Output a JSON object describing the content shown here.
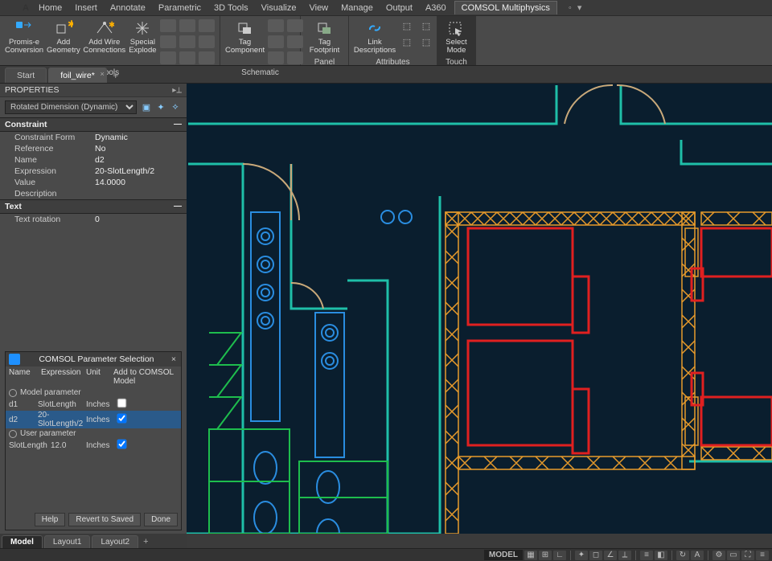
{
  "menu": {
    "items": [
      "Home",
      "Insert",
      "Annotate",
      "Parametric",
      "3D Tools",
      "Visualize",
      "View",
      "Manage",
      "Output",
      "A360"
    ],
    "comsol_tab": "COMSOL Multiphysics",
    "help_glyph": "◦ ▾"
  },
  "ribbon": {
    "groups": {
      "tools": {
        "title": "Tools",
        "buttons": {
          "promise": "Promis-e Conversion",
          "addgeom": "Add Geometry",
          "addwire": "Add Wire Connections",
          "explode": "Special Explode"
        }
      },
      "schematic": {
        "title": "Schematic",
        "buttons": {
          "tagcomp": "Tag Component"
        }
      },
      "panel": {
        "title": "Panel",
        "buttons": {
          "tagfp": "Tag Footprint"
        }
      },
      "attributes": {
        "title": "Attributes",
        "buttons": {
          "linkdesc": "Link Descriptions"
        }
      },
      "touch": {
        "title": "Touch",
        "buttons": {
          "selmode": "Select Mode"
        }
      }
    }
  },
  "file_tabs": {
    "start": "Start",
    "foil": "foil_wire*",
    "add": "+"
  },
  "properties": {
    "title": "PROPERTIES",
    "selection": "Rotated Dimension (Dynamic)",
    "constraint": {
      "header": "Constraint",
      "rows": {
        "form_l": "Constraint Form",
        "form_v": "Dynamic",
        "ref_l": "Reference",
        "ref_v": "No",
        "name_l": "Name",
        "name_v": "d2",
        "expr_l": "Expression",
        "expr_v": "20-SlotLength/2",
        "val_l": "Value",
        "val_v": "14.0000",
        "desc_l": "Description",
        "desc_v": ""
      }
    },
    "text": {
      "header": "Text",
      "rows": {
        "rot_l": "Text rotation",
        "rot_v": "0"
      }
    }
  },
  "comsol_dialog": {
    "title": "COMSOL Parameter Selection",
    "headers": {
      "c1": "Name",
      "c2": "Expression",
      "c3": "Unit",
      "c4": "Add to COMSOL Model"
    },
    "model_param_label": "Model parameter",
    "user_param_label": "User parameter",
    "rows": {
      "d1": {
        "name": "d1",
        "expr": "SlotLength",
        "unit": "Inches",
        "checked": false,
        "active": false
      },
      "d2": {
        "name": "d2",
        "expr": "20-SlotLength/2",
        "unit": "Inches",
        "checked": true,
        "active": true
      },
      "slot": {
        "name": "SlotLength",
        "expr": "12.0",
        "unit": "Inches",
        "checked": true,
        "active": false
      }
    },
    "buttons": {
      "help": "Help",
      "revert": "Revert to Saved",
      "done": "Done"
    }
  },
  "bottom_tabs": {
    "model": "Model",
    "layout1": "Layout1",
    "layout2": "Layout2",
    "add": "+"
  },
  "status": {
    "model_label": "MODEL"
  }
}
